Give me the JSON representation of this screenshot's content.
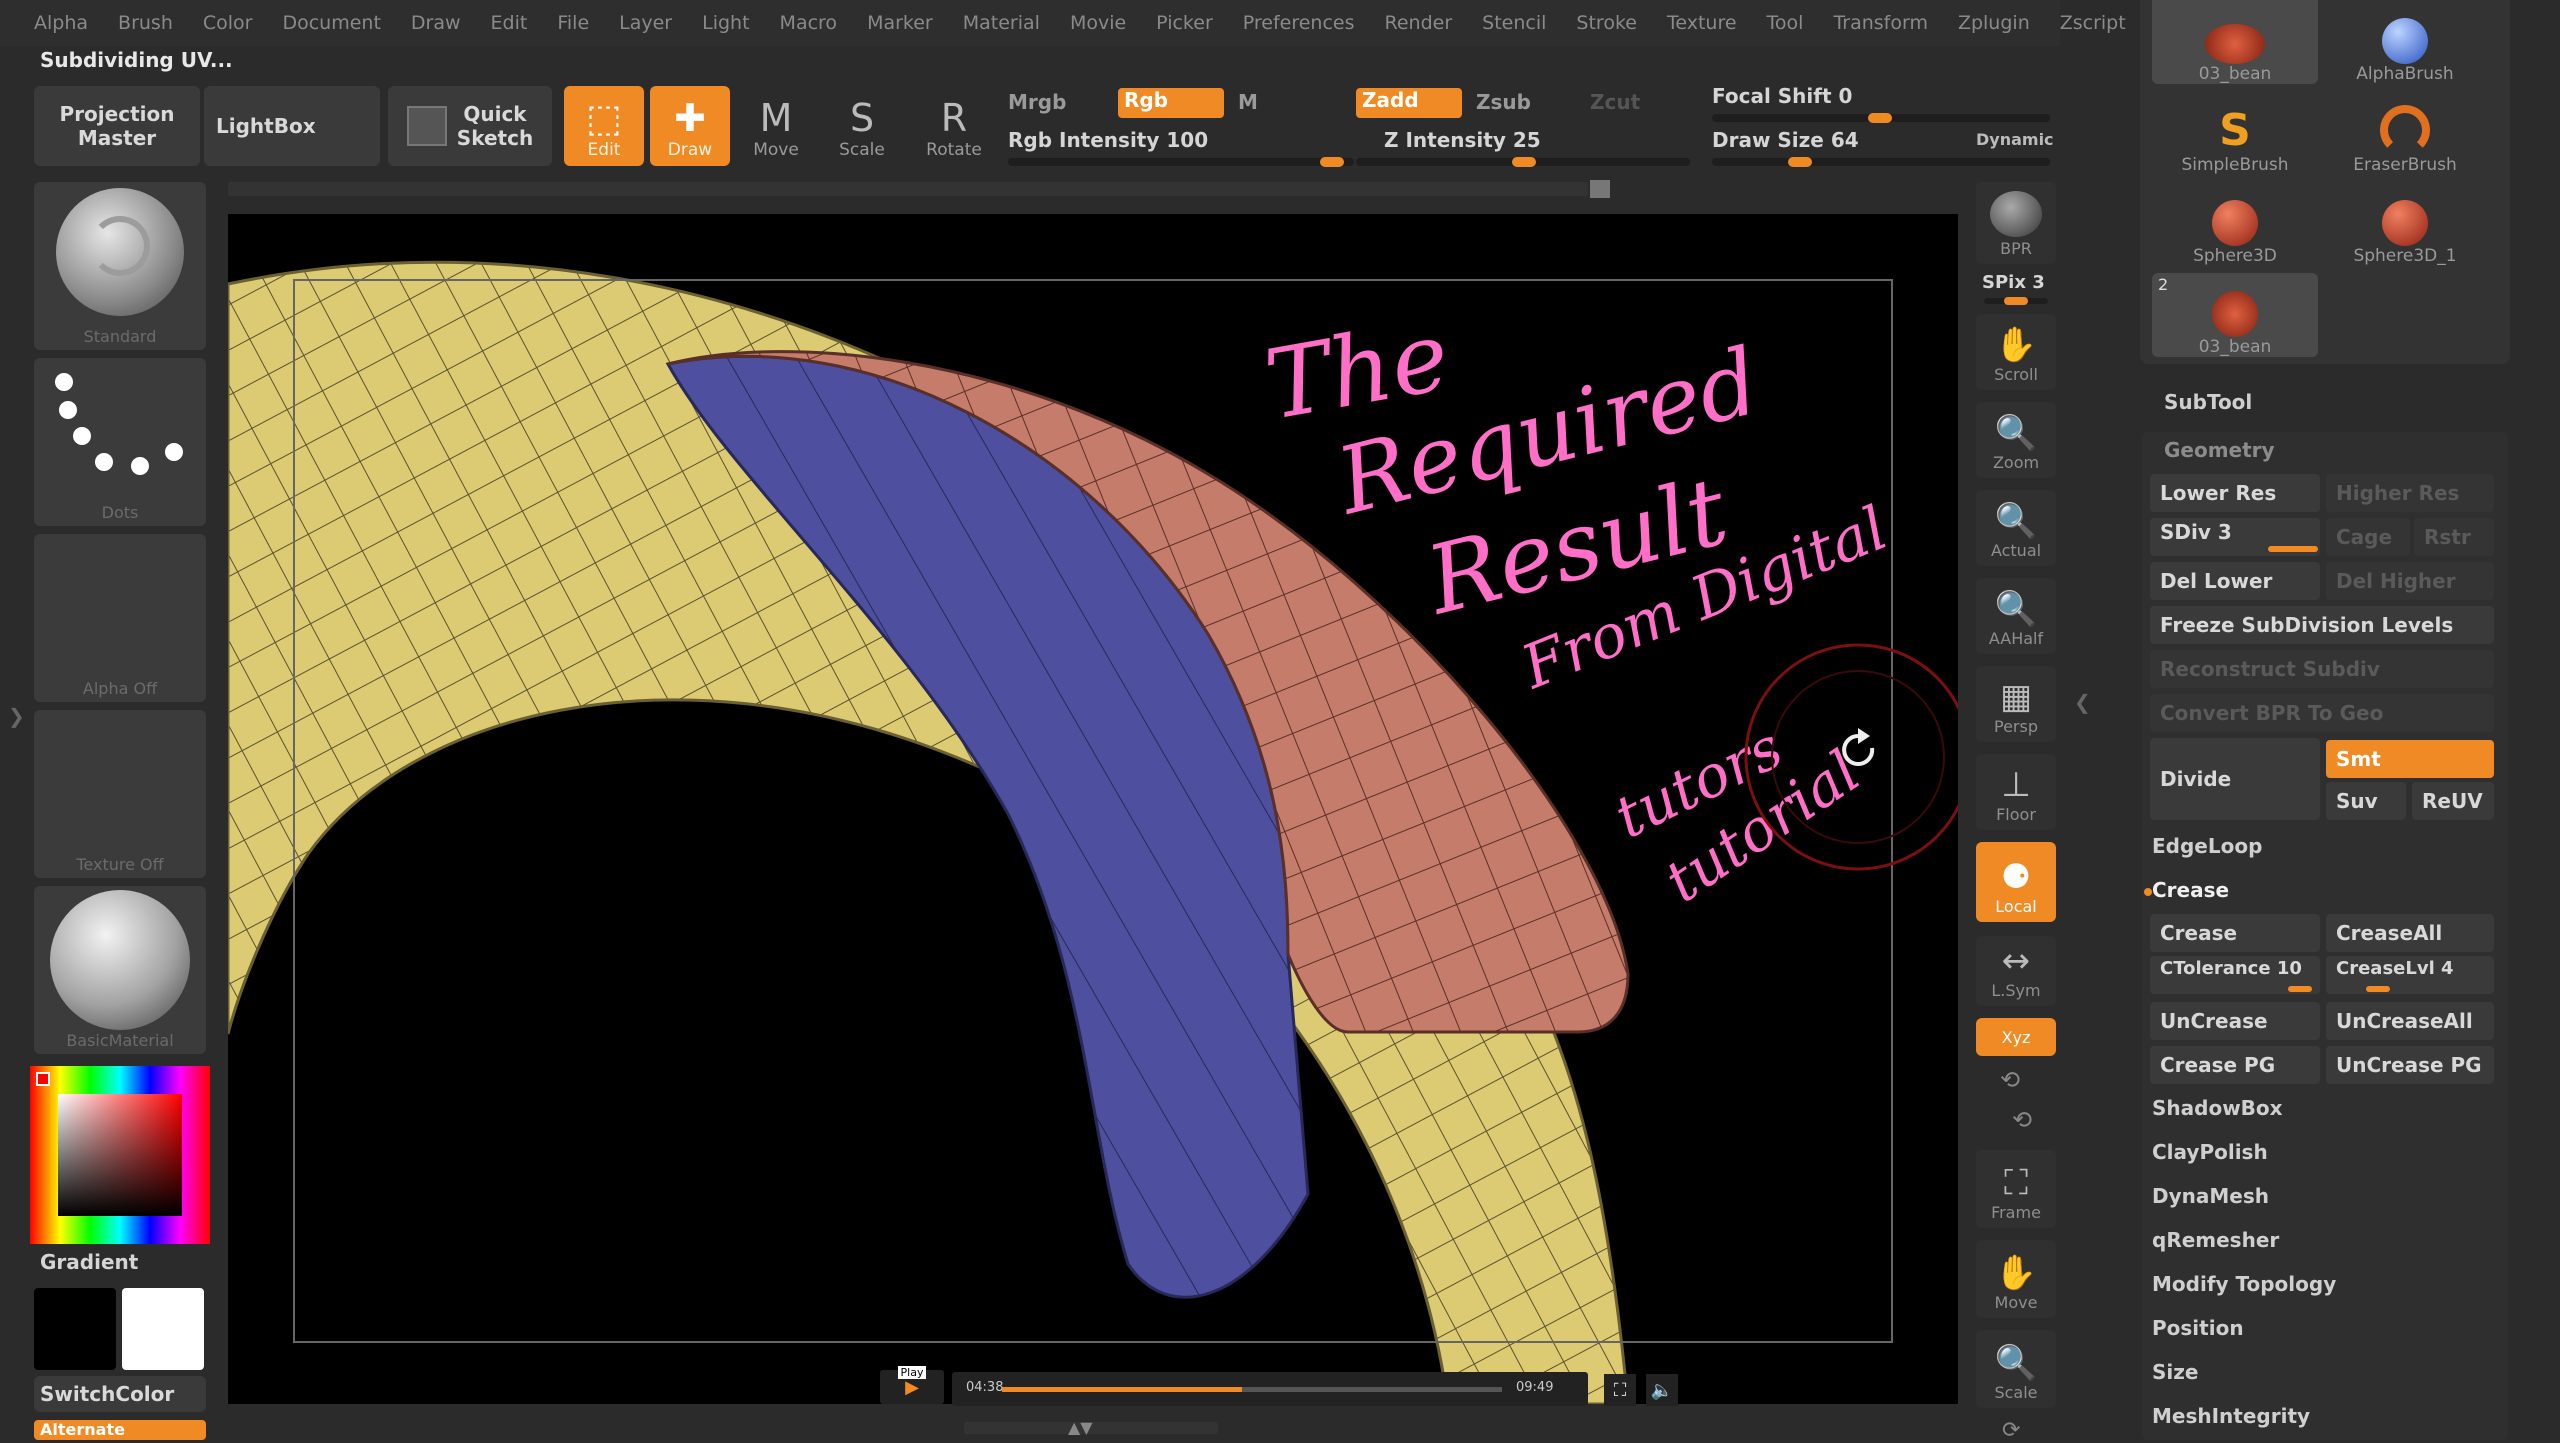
{
  "app": {
    "status": "Subdividing UV..."
  },
  "menu": [
    "Alpha",
    "Brush",
    "Color",
    "Document",
    "Draw",
    "Edit",
    "File",
    "Layer",
    "Light",
    "Macro",
    "Marker",
    "Material",
    "Movie",
    "Picker",
    "Preferences",
    "Render",
    "Stencil",
    "Stroke",
    "Texture",
    "Tool",
    "Transform",
    "Zplugin",
    "Zscript"
  ],
  "toolbar": {
    "projection_master": "Projection\nMaster",
    "lightbox": "LightBox",
    "quick_sketch": "Quick\nSketch",
    "edit": "Edit",
    "draw": "Draw",
    "move": "Move",
    "scale": "Scale",
    "rotate": "Rotate",
    "mrgb": "Mrgb",
    "rgb": "Rgb",
    "m": "M",
    "rgb_intensity": "Rgb Intensity 100",
    "zadd": "Zadd",
    "zsub": "Zsub",
    "zcut": "Zcut",
    "z_intensity": "Z Intensity 25",
    "focal_shift": "Focal Shift 0",
    "draw_size": "Draw Size 64",
    "dynamic": "Dynamic"
  },
  "left_shelf": {
    "standard": "Standard",
    "dots": "Dots",
    "alpha_off": "Alpha Off",
    "texture_off": "Texture Off",
    "basic_material": "BasicMaterial",
    "gradient": "Gradient",
    "switch_color": "SwitchColor",
    "alternate": "Alternate"
  },
  "right_shelf": {
    "bpr": "BPR",
    "spix": "SPix 3",
    "scroll": "Scroll",
    "zoom": "Zoom",
    "actual": "Actual",
    "aahalf": "AAHalf",
    "persp": "Persp",
    "floor": "Floor",
    "local": "Local",
    "lsym": "L.Sym",
    "xyz": "Xyz",
    "frame": "Frame",
    "move": "Move",
    "scale": "Scale"
  },
  "brushes": [
    {
      "name": "03_bean"
    },
    {
      "name": "AlphaBrush"
    },
    {
      "name": "SimpleBrush"
    },
    {
      "name": "EraserBrush"
    },
    {
      "name": "Sphere3D"
    },
    {
      "name": "Sphere3D_1"
    },
    {
      "name": "03_bean",
      "badge": "2"
    }
  ],
  "panel": {
    "subtool": "SubTool",
    "geometry": "Geometry",
    "lower_res": "Lower Res",
    "higher_res": "Higher Res",
    "sdiv": "SDiv 3",
    "cage": "Cage",
    "rstr": "Rstr",
    "del_lower": "Del Lower",
    "del_higher": "Del Higher",
    "freeze": "Freeze SubDivision Levels",
    "reconstruct": "Reconstruct Subdiv",
    "convert_bpr": "Convert BPR To Geo",
    "divide": "Divide",
    "smt": "Smt",
    "suv": "Suv",
    "reuv": "ReUV",
    "edgeloop": "EdgeLoop",
    "crease_header": "Crease",
    "crease": "Crease",
    "crease_all": "CreaseAll",
    "ctolerance": "CTolerance 10",
    "crease_lvl": "CreaseLvl 4",
    "uncrease": "UnCrease",
    "uncrease_all": "UnCreaseAll",
    "crease_pg": "Crease PG",
    "uncrease_pg": "UnCrease PG",
    "shadowbox": "ShadowBox",
    "claypolish": "ClayPolish",
    "dynamesh": "DynaMesh",
    "qremesher": "qRemesher",
    "modify_topology": "Modify Topology",
    "position": "Position",
    "size": "Size",
    "meshintegrity": "MeshIntegrity"
  },
  "annotation": {
    "line1": "The",
    "line2": "Required",
    "line3": "Result",
    "line4": "From Digital",
    "line5": "tutors",
    "line6": "tutorial"
  },
  "video": {
    "play": "Play",
    "current_time": "04:38",
    "total_time": "09:49",
    "progress": 0.48
  },
  "colors": {
    "accent": "#f08a24",
    "mesh_yellow": "#d9c86e",
    "mesh_blue": "#4f4fa0",
    "mesh_pink": "#c47b6c",
    "ink": "#ff6ec7"
  }
}
